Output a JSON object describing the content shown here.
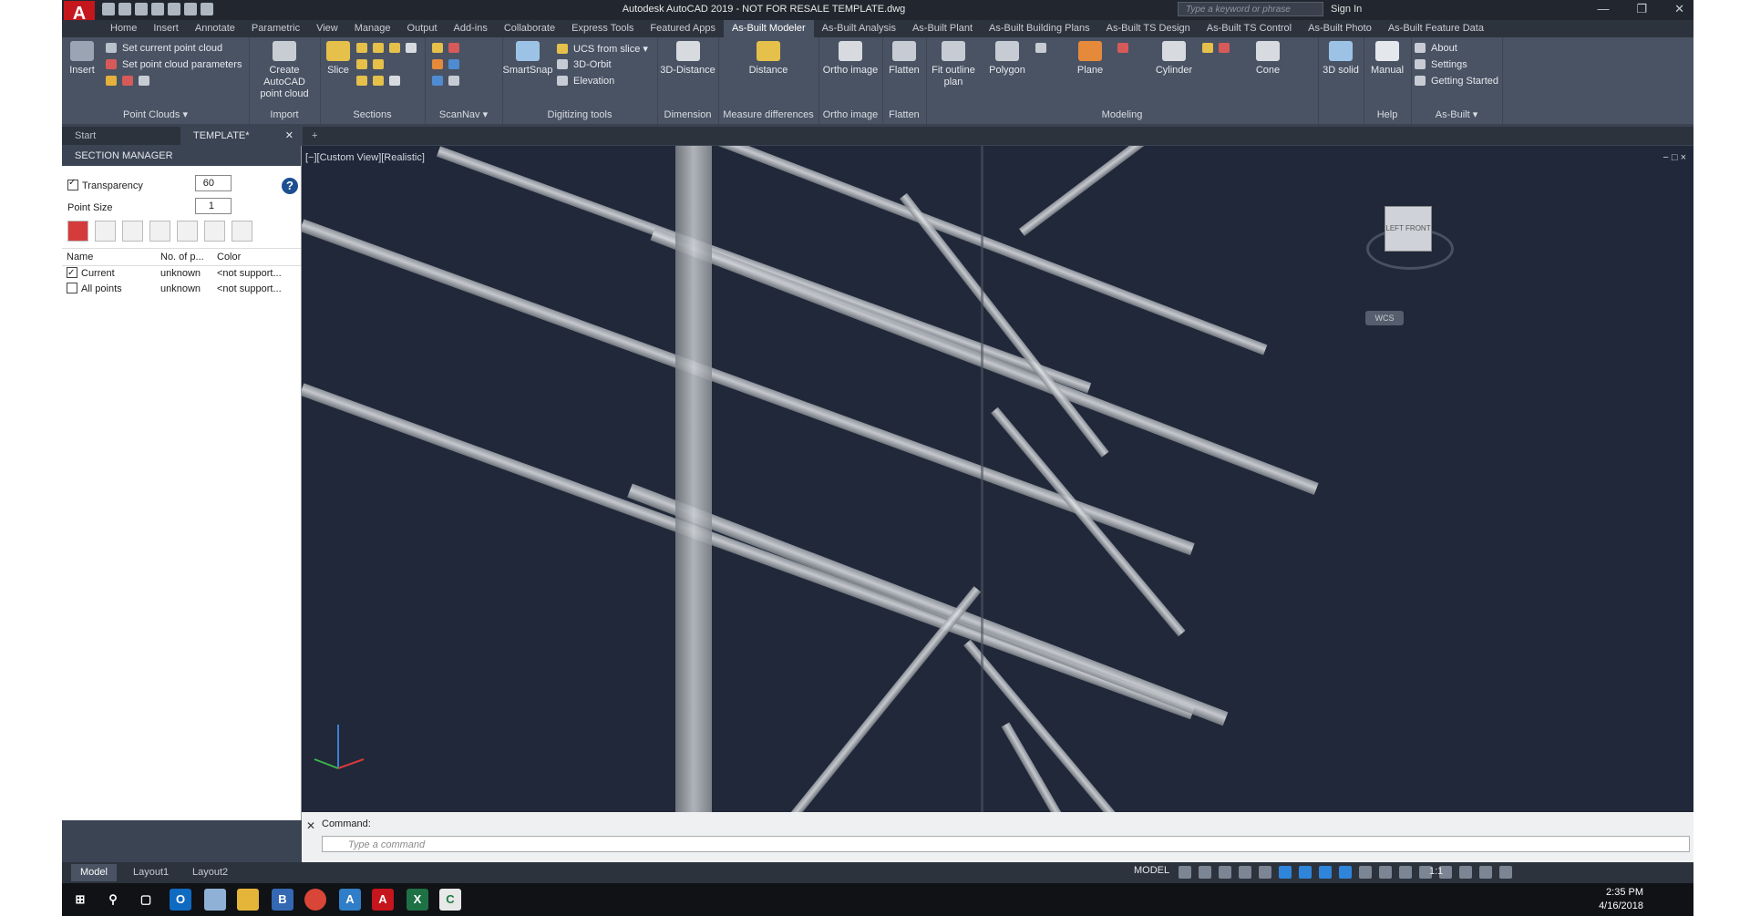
{
  "titlebar": {
    "app_logo": "A",
    "title": "Autodesk AutoCAD 2019 - NOT FOR RESALE   TEMPLATE.dwg",
    "search_placeholder": "Type a keyword or phrase",
    "signin": "Sign In"
  },
  "ribbon_tabs": [
    "Home",
    "Insert",
    "Annotate",
    "Parametric",
    "View",
    "Manage",
    "Output",
    "Add-ins",
    "Collaborate",
    "Express Tools",
    "Featured Apps",
    "As-Built Modeler",
    "As-Built Analysis",
    "As-Built Plant",
    "As-Built Building Plans",
    "As-Built TS Design",
    "As-Built TS Control",
    "As-Built Photo",
    "As-Built Feature Data"
  ],
  "ribbon": {
    "insert": "Insert",
    "set_current": "Set current point cloud",
    "set_params": "Set point cloud parameters",
    "point_clouds": "Point Clouds",
    "create_pc": "Create AutoCAD",
    "create_pc2": "point cloud",
    "import": "Import",
    "slice": "Slice",
    "sections": "Sections",
    "scannav": "ScanNav",
    "smartsnap": "SmartSnap",
    "ucs_from_slice": "UCS from slice",
    "orbit3d": "3D-Orbit",
    "elevation": "Elevation",
    "digitizing_tools": "Digitizing tools",
    "distance3d": "3D-Distance",
    "dimension": "Dimension",
    "distance": "Distance",
    "measure_diff": "Measure differences",
    "ortho_image": "Ortho image",
    "ortho_image_group": "Ortho image",
    "flatten": "Flatten",
    "flatten_group": "Flatten",
    "fit_outline": "Fit outline",
    "fit_outline2": "plan",
    "polygon": "Polygon",
    "plane": "Plane",
    "cylinder": "Cylinder",
    "cone": "Cone",
    "solid3d": "3D solid",
    "modeling": "Modeling",
    "manual": "Manual",
    "help": "Help",
    "about": "About",
    "settings": "Settings",
    "getting_started": "Getting Started",
    "asbuilt": "As-Built"
  },
  "doctabs": {
    "start": "Start",
    "template": "TEMPLATE*",
    "plus": "+"
  },
  "palette": {
    "title": "SECTION MANAGER",
    "transparency_label": "Transparency",
    "transparency_value": "60",
    "point_size_label": "Point Size",
    "point_size_value": "1",
    "help": "?",
    "columns": [
      "Name",
      "No. of p...",
      "Color"
    ],
    "rows": [
      {
        "name": "Current",
        "count": "unknown",
        "color": "<not support...",
        "checked": true
      },
      {
        "name": "All points",
        "count": "unknown",
        "color": "<not support...",
        "checked": false
      }
    ]
  },
  "viewport": {
    "label": "[−][Custom View][Realistic]",
    "ctrls": "− □ ×",
    "viewcube_left": "LEFT",
    "viewcube_front": "FRONT",
    "wcs": "WCS"
  },
  "command": {
    "history": "Command:",
    "placeholder": "Type a command"
  },
  "layout_tabs": [
    "Model",
    "Layout1",
    "Layout2"
  ],
  "status": {
    "model": "MODEL",
    "scale": "1:1"
  },
  "taskbar": {
    "time": "2:35 PM",
    "date": "4/16/2018"
  }
}
